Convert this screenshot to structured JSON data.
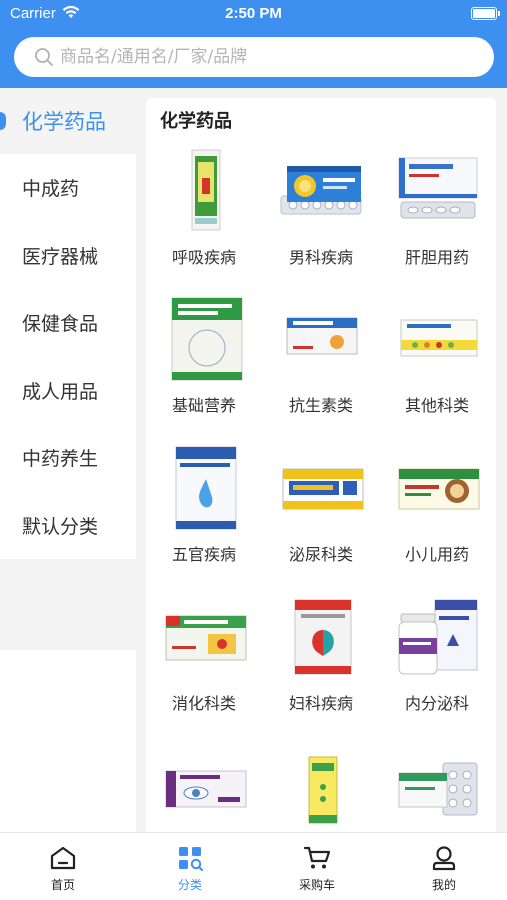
{
  "statusbar": {
    "carrier": "Carrier",
    "time": "2:50 PM"
  },
  "search": {
    "placeholder": "商品名/通用名/厂家/品牌"
  },
  "sidebar": {
    "items": [
      {
        "label": "化学药品",
        "active": true
      },
      {
        "label": "中成药"
      },
      {
        "label": "医疗器械"
      },
      {
        "label": "保健食品"
      },
      {
        "label": "成人用品"
      },
      {
        "label": "中药养生"
      },
      {
        "label": "默认分类"
      }
    ]
  },
  "content": {
    "title": "化学药品",
    "categories": [
      {
        "label": "呼吸疾病",
        "image": "medicine-box-vertical-green"
      },
      {
        "label": "男科疾病",
        "image": "medicine-box-blue-blister"
      },
      {
        "label": "肝胆用药",
        "image": "medicine-box-white-blister"
      },
      {
        "label": "基础营养",
        "image": "medicine-box-green-white"
      },
      {
        "label": "抗生素类",
        "image": "medicine-box-blue-orange"
      },
      {
        "label": "其他科类",
        "image": "medicine-box-white-yellow"
      },
      {
        "label": "五官疾病",
        "image": "medicine-box-white-blue-drop"
      },
      {
        "label": "泌尿科类",
        "image": "medicine-box-yellow-blue"
      },
      {
        "label": "小儿用药",
        "image": "medicine-box-cartoon-monkey"
      },
      {
        "label": "消化科类",
        "image": "medicine-box-green-red"
      },
      {
        "label": "妇科疾病",
        "image": "medicine-box-red-teal"
      },
      {
        "label": "内分泌科",
        "image": "medicine-bottle-white-purple"
      },
      {
        "label": "",
        "image": "medicine-box-purple-eye"
      },
      {
        "label": "",
        "image": "medicine-box-yellow-green"
      },
      {
        "label": "",
        "image": "medicine-box-white-blister-green"
      }
    ]
  },
  "tabbar": {
    "items": [
      {
        "label": "首页",
        "icon": "home-icon"
      },
      {
        "label": "分类",
        "icon": "category-icon",
        "active": true
      },
      {
        "label": "采购车",
        "icon": "cart-icon"
      },
      {
        "label": "我的",
        "icon": "user-icon"
      }
    ]
  },
  "colors": {
    "accent": "#3d8ff0",
    "background": "#f4f4f4"
  }
}
